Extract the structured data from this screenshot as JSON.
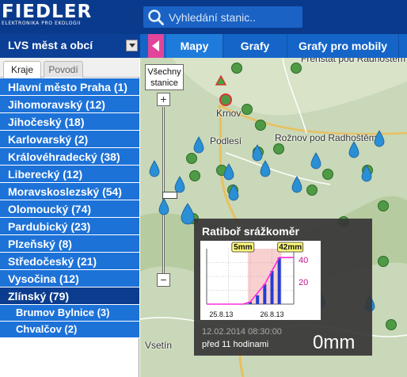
{
  "header": {
    "logo_main": "FIEDLER",
    "logo_sub": "ELEKTRONIKA PRO EKOLOGII",
    "search_placeholder": "Vyhledání stanic.."
  },
  "nav": {
    "select_label": "LVS měst a obcí",
    "tabs": [
      {
        "label": "Mapy",
        "active": true
      },
      {
        "label": "Grafy",
        "active": false
      },
      {
        "label": "Grafy pro mobily",
        "active": false
      }
    ]
  },
  "sidebar": {
    "subtabs": [
      {
        "label": "Kraje",
        "active": true
      },
      {
        "label": "Povodí",
        "active": false
      }
    ],
    "regions": [
      {
        "label": "Hlavní město Praha (1)",
        "selected": false
      },
      {
        "label": "Jihomoravský (12)",
        "selected": false
      },
      {
        "label": "Jihočeský (18)",
        "selected": false
      },
      {
        "label": "Karlovarský (2)",
        "selected": false
      },
      {
        "label": "Královéhradecký (38)",
        "selected": false
      },
      {
        "label": "Liberecký (12)",
        "selected": false
      },
      {
        "label": "Moravskoslezský (54)",
        "selected": false
      },
      {
        "label": "Olomoucký (74)",
        "selected": false
      },
      {
        "label": "Pardubický (23)",
        "selected": false
      },
      {
        "label": "Plzeňský (8)",
        "selected": false
      },
      {
        "label": "Středočeský (21)",
        "selected": false
      },
      {
        "label": "Vysočina (12)",
        "selected": false
      },
      {
        "label": "Zlínský (79)",
        "selected": true
      }
    ],
    "subregions": [
      {
        "label": "Brumov Bylnice (3)"
      },
      {
        "label": "Chvalčov (2)"
      }
    ]
  },
  "map": {
    "all_stations_label": "Všechny stanice",
    "towns": [
      "Frenštát pod Radhoštěm",
      "Krnov",
      "Podlesí",
      "Rožnov pod Radhoštěm",
      "Vsetín"
    ],
    "zoom_in": "+",
    "zoom_out": "−",
    "colors": {
      "station_green": "#4f9a45",
      "station_rain": "#2a8fd4",
      "selected_ring": "#d33"
    }
  },
  "popup": {
    "title": "Ratiboř srážkoměr",
    "date": "12.02.2014 08:30:00",
    "ago": "před 11 hodinami",
    "value": "0mm"
  },
  "chart_data": {
    "type": "bar",
    "title": "",
    "x_tick_labels": [
      "25.8.13",
      "26.8.13"
    ],
    "y_tick_labels": [
      "40",
      "20"
    ],
    "annotations": [
      "5mm",
      "42mm"
    ],
    "series": [
      {
        "values": [
          0,
          0,
          0,
          0,
          0,
          0,
          2,
          8,
          18,
          30,
          42,
          0,
          0
        ]
      }
    ],
    "cumulative": [
      0,
      0,
      0,
      0,
      0,
      0,
      2,
      10,
      18,
      30,
      42,
      42,
      42
    ],
    "colors": {
      "bars": "#1f3fd0",
      "line": "#ff2ae0",
      "highlight": "#f5b0b0"
    }
  }
}
